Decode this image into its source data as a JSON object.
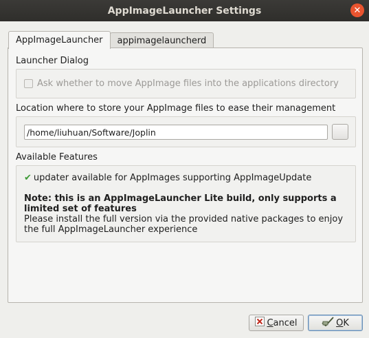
{
  "window": {
    "title": "AppImageLauncher Settings",
    "close_glyph": "✕"
  },
  "tabs": [
    {
      "label": "AppImageLauncher",
      "active": true
    },
    {
      "label": "appimagelauncherd",
      "active": false
    }
  ],
  "launcher_dialog": {
    "heading": "Launcher Dialog",
    "checkbox_label": "Ask whether to move AppImage files into the applications directory",
    "checked": false,
    "disabled": true
  },
  "location": {
    "heading": "Location where to store your AppImage files to ease their management",
    "path_value": "/home/liuhuan/Software/Joplin"
  },
  "features": {
    "heading": "Available Features",
    "check_glyph": "✔",
    "item": "updater available for AppImages supporting AppImageUpdate",
    "note_bold": "Note: this is an AppImageLauncher Lite build, only supports a limited set of features",
    "note_text": "Please install the full version via the provided native packages to enjoy the full AppImageLauncher experience"
  },
  "buttons": {
    "cancel_mnemonic": "C",
    "cancel_rest": "ancel",
    "ok_mnemonic": "O",
    "ok_rest": "K"
  },
  "colors": {
    "titlebar": "#2f2e2b",
    "close_button": "#e9542f",
    "check_green": "#3d9a36"
  }
}
